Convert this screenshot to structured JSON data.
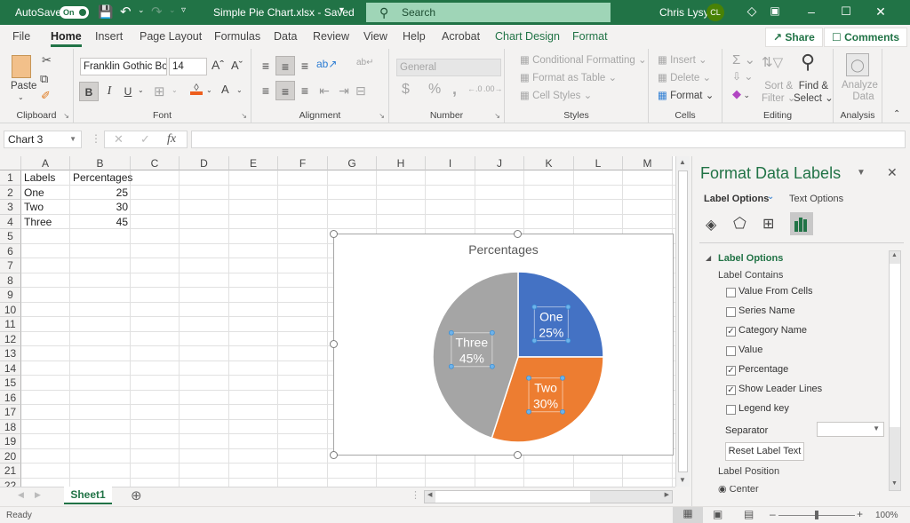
{
  "titlebar": {
    "autosave_label": "AutoSave",
    "autosave_state": "On",
    "file_title": "Simple Pie Chart.xlsx  -  Saved",
    "search_placeholder": "Search",
    "user_name": "Chris Lysy",
    "user_initials": "CL"
  },
  "ribbon_tabs": [
    "File",
    "Home",
    "Insert",
    "Page Layout",
    "Formulas",
    "Data",
    "Review",
    "View",
    "Help",
    "Acrobat",
    "Chart Design",
    "Format"
  ],
  "active_tab": "Home",
  "top_buttons": {
    "share": "Share",
    "comments": "Comments"
  },
  "ribbon": {
    "clipboard": {
      "label": "Clipboard",
      "paste": "Paste"
    },
    "font": {
      "label": "Font",
      "font_name": "Franklin Gothic Boo",
      "font_size": "14",
      "bold": "B",
      "italic": "I",
      "underline": "U"
    },
    "alignment": {
      "label": "Alignment"
    },
    "number": {
      "label": "Number",
      "format": "General",
      "currency": "$",
      "percent": "%",
      "comma": ","
    },
    "styles": {
      "label": "Styles",
      "conditional": "Conditional Formatting",
      "format_table": "Format as Table",
      "cell_styles": "Cell Styles"
    },
    "cells": {
      "label": "Cells",
      "insert": "Insert",
      "delete": "Delete",
      "format": "Format"
    },
    "editing": {
      "label": "Editing",
      "sort_filter_1": "Sort &",
      "sort_filter_2": "Filter",
      "find_select_1": "Find &",
      "find_select_2": "Select"
    },
    "analysis": {
      "label": "Analysis",
      "analyze_1": "Analyze",
      "analyze_2": "Data"
    }
  },
  "formula_bar": {
    "name_box": "Chart 3",
    "formula": ""
  },
  "columns": [
    "A",
    "B",
    "C",
    "D",
    "E",
    "F",
    "G",
    "H",
    "I",
    "J",
    "K",
    "L",
    "M"
  ],
  "rows": [
    "1",
    "2",
    "3",
    "4",
    "5",
    "6",
    "7",
    "8",
    "9",
    "10",
    "11",
    "12",
    "13",
    "14",
    "15",
    "16",
    "17",
    "18",
    "19",
    "20",
    "21",
    "22"
  ],
  "cells": {
    "A1": "Labels",
    "B1": "Percentages",
    "A2": "One",
    "B2": "25",
    "A3": "Two",
    "B3": "30",
    "A4": "Three",
    "B4": "45"
  },
  "chart_data": {
    "type": "pie",
    "title": "Percentages",
    "categories": [
      "One",
      "Two",
      "Three"
    ],
    "values": [
      25,
      30,
      45
    ],
    "colors": [
      "#4472c4",
      "#ed7d31",
      "#a5a5a5"
    ],
    "data_labels": [
      {
        "name": "One",
        "pct": "25%"
      },
      {
        "name": "Two",
        "pct": "30%"
      },
      {
        "name": "Three",
        "pct": "45%"
      }
    ],
    "legend": "none"
  },
  "pane": {
    "title": "Format Data Labels",
    "tab_label_options": "Label Options",
    "tab_text_options": "Text Options",
    "section": "Label Options",
    "label_contains": "Label Contains",
    "checkboxes": [
      {
        "label": "Value From Cells",
        "checked": false
      },
      {
        "label": "Series Name",
        "checked": false
      },
      {
        "label": "Category Name",
        "checked": true
      },
      {
        "label": "Value",
        "checked": false
      },
      {
        "label": "Percentage",
        "checked": true
      },
      {
        "label": "Show Leader Lines",
        "checked": true
      },
      {
        "label": "Legend key",
        "checked": false
      }
    ],
    "separator_label": "Separator",
    "separator_value": "",
    "reset_button": "Reset Label Text",
    "label_position": "Label Position",
    "position_center": "Center"
  },
  "sheet_tabs": [
    "Sheet1"
  ],
  "status": {
    "ready": "Ready",
    "zoom": "100%"
  },
  "colors": {
    "brand": "#217346",
    "accent_text": "#217346"
  }
}
